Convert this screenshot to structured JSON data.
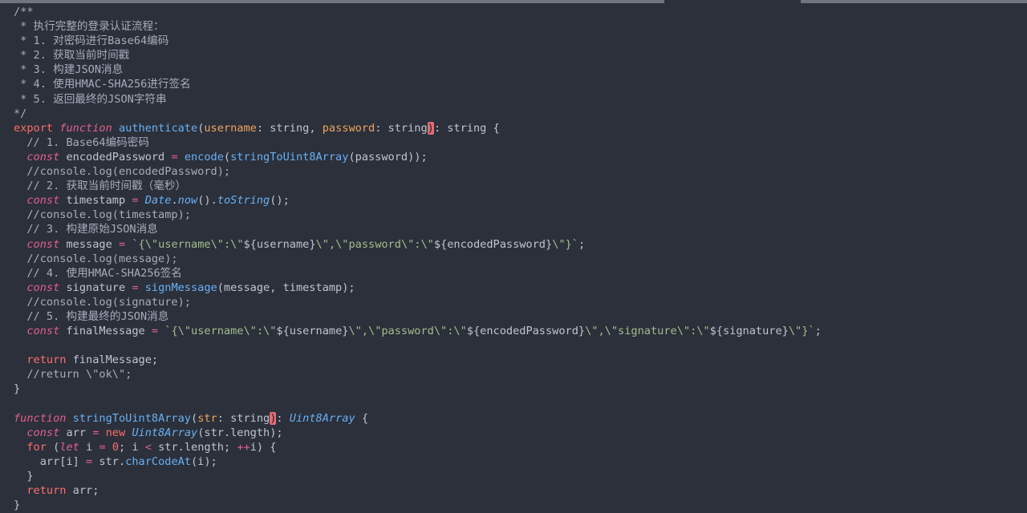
{
  "editor": {
    "lines": [
      {
        "tokens": [
          {
            "t": "/**",
            "c": "c-comment"
          }
        ]
      },
      {
        "tokens": [
          {
            "t": " * 执行完整的登录认证流程：",
            "c": "c-comment"
          }
        ]
      },
      {
        "tokens": [
          {
            "t": " * 1. 对密码进行Base64编码",
            "c": "c-comment"
          }
        ]
      },
      {
        "tokens": [
          {
            "t": " * 2. 获取当前时间戳",
            "c": "c-comment"
          }
        ]
      },
      {
        "tokens": [
          {
            "t": " * 3. 构建JSON消息",
            "c": "c-comment"
          }
        ]
      },
      {
        "tokens": [
          {
            "t": " * 4. 使用HMAC-SHA256进行签名",
            "c": "c-comment"
          }
        ]
      },
      {
        "tokens": [
          {
            "t": " * 5. 返回最终的JSON字符串",
            "c": "c-comment"
          }
        ]
      },
      {
        "tokens": [
          {
            "t": "*/",
            "c": "c-comment"
          }
        ]
      },
      {
        "tokens": [
          {
            "t": "export ",
            "c": "c-kw"
          },
          {
            "t": "function ",
            "c": "c-kwi"
          },
          {
            "t": "authenticate",
            "c": "c-fn2"
          },
          {
            "t": "(",
            "c": ""
          },
          {
            "t": "username",
            "c": "c-param"
          },
          {
            "t": ": string, ",
            "c": ""
          },
          {
            "t": "password",
            "c": "c-param"
          },
          {
            "t": ": string",
            "c": ""
          },
          {
            "t": ")",
            "c": "paren-hi"
          },
          {
            "t": ": string {",
            "c": ""
          }
        ]
      },
      {
        "tokens": [
          {
            "t": "  // 1. Base64编码密码",
            "c": "c-comment"
          }
        ]
      },
      {
        "tokens": [
          {
            "t": "  ",
            "c": ""
          },
          {
            "t": "const ",
            "c": "c-kwi"
          },
          {
            "t": "encodedPassword ",
            "c": ""
          },
          {
            "t": "= ",
            "c": "c-op"
          },
          {
            "t": "encode",
            "c": "c-fn2"
          },
          {
            "t": "(",
            "c": ""
          },
          {
            "t": "stringToUint8Array",
            "c": "c-fn2"
          },
          {
            "t": "(password));",
            "c": ""
          }
        ]
      },
      {
        "tokens": [
          {
            "t": "  //console.log(encodedPassword);",
            "c": "c-comment"
          }
        ]
      },
      {
        "tokens": [
          {
            "t": "  // 2. 获取当前时间戳（毫秒）",
            "c": "c-comment"
          }
        ]
      },
      {
        "tokens": [
          {
            "t": "  ",
            "c": ""
          },
          {
            "t": "const ",
            "c": "c-kwi"
          },
          {
            "t": "timestamp ",
            "c": ""
          },
          {
            "t": "= ",
            "c": "c-op"
          },
          {
            "t": "Date",
            "c": "c-type"
          },
          {
            "t": ".",
            "c": ""
          },
          {
            "t": "now",
            "c": "c-type"
          },
          {
            "t": "().",
            "c": ""
          },
          {
            "t": "toString",
            "c": "c-type"
          },
          {
            "t": "();",
            "c": ""
          }
        ]
      },
      {
        "tokens": [
          {
            "t": "  //console.log(timestamp);",
            "c": "c-comment"
          }
        ]
      },
      {
        "tokens": [
          {
            "t": "  // 3. 构建原始JSON消息",
            "c": "c-comment"
          }
        ]
      },
      {
        "tokens": [
          {
            "t": "  ",
            "c": ""
          },
          {
            "t": "const ",
            "c": "c-kwi"
          },
          {
            "t": "message ",
            "c": ""
          },
          {
            "t": "= ",
            "c": "c-op"
          },
          {
            "t": "`{\\\"",
            "c": "c-str"
          },
          {
            "t": "username",
            "c": "c-str"
          },
          {
            "t": "\\\":\\\"",
            "c": "c-str"
          },
          {
            "t": "${username}",
            "c": "c-tmpl"
          },
          {
            "t": "\\\",\\\"",
            "c": "c-str"
          },
          {
            "t": "password",
            "c": "c-str"
          },
          {
            "t": "\\\":\\\"",
            "c": "c-str"
          },
          {
            "t": "${encodedPassword}",
            "c": "c-tmpl"
          },
          {
            "t": "\\\"}`",
            "c": "c-str"
          },
          {
            "t": ";",
            "c": ""
          }
        ]
      },
      {
        "tokens": [
          {
            "t": "  //console.log(message);",
            "c": "c-comment"
          }
        ]
      },
      {
        "tokens": [
          {
            "t": "  // 4. 使用HMAC-SHA256签名",
            "c": "c-comment"
          }
        ]
      },
      {
        "tokens": [
          {
            "t": "  ",
            "c": ""
          },
          {
            "t": "const ",
            "c": "c-kwi"
          },
          {
            "t": "signature ",
            "c": ""
          },
          {
            "t": "= ",
            "c": "c-op"
          },
          {
            "t": "signMessage",
            "c": "c-fn2"
          },
          {
            "t": "(message, timestamp);",
            "c": ""
          }
        ]
      },
      {
        "tokens": [
          {
            "t": "  //console.log(signature);",
            "c": "c-comment"
          }
        ]
      },
      {
        "tokens": [
          {
            "t": "  // 5. 构建最终的JSON消息",
            "c": "c-comment"
          }
        ]
      },
      {
        "tokens": [
          {
            "t": "  ",
            "c": ""
          },
          {
            "t": "const ",
            "c": "c-kwi"
          },
          {
            "t": "finalMessage ",
            "c": ""
          },
          {
            "t": "= ",
            "c": "c-op"
          },
          {
            "t": "`{\\\"",
            "c": "c-str"
          },
          {
            "t": "username",
            "c": "c-str"
          },
          {
            "t": "\\\":\\\"",
            "c": "c-str"
          },
          {
            "t": "${username}",
            "c": "c-tmpl"
          },
          {
            "t": "\\\",\\\"",
            "c": "c-str"
          },
          {
            "t": "password",
            "c": "c-str"
          },
          {
            "t": "\\\":\\\"",
            "c": "c-str"
          },
          {
            "t": "${encodedPassword}",
            "c": "c-tmpl"
          },
          {
            "t": "\\\",\\\"",
            "c": "c-str"
          },
          {
            "t": "signature",
            "c": "c-str"
          },
          {
            "t": "\\\":\\\"",
            "c": "c-str"
          },
          {
            "t": "${signature}",
            "c": "c-tmpl"
          },
          {
            "t": "\\\"}`",
            "c": "c-str"
          },
          {
            "t": ";",
            "c": ""
          }
        ]
      },
      {
        "tokens": [
          {
            "t": "",
            "c": ""
          }
        ]
      },
      {
        "tokens": [
          {
            "t": "  ",
            "c": ""
          },
          {
            "t": "return ",
            "c": "c-kw"
          },
          {
            "t": "finalMessage;",
            "c": ""
          }
        ]
      },
      {
        "tokens": [
          {
            "t": "  //return \\\"ok\\\";",
            "c": "c-comment"
          }
        ]
      },
      {
        "tokens": [
          {
            "t": "}",
            "c": ""
          }
        ]
      },
      {
        "tokens": [
          {
            "t": "",
            "c": ""
          }
        ]
      },
      {
        "tokens": [
          {
            "t": "function ",
            "c": "c-kwi"
          },
          {
            "t": "stringToUint8Array",
            "c": "c-fn2"
          },
          {
            "t": "(",
            "c": ""
          },
          {
            "t": "str",
            "c": "c-param"
          },
          {
            "t": ": string",
            "c": ""
          },
          {
            "t": ")",
            "c": "paren-hi"
          },
          {
            "t": ": ",
            "c": ""
          },
          {
            "t": "Uint8Array",
            "c": "c-type"
          },
          {
            "t": " {",
            "c": ""
          }
        ]
      },
      {
        "tokens": [
          {
            "t": "  ",
            "c": ""
          },
          {
            "t": "const ",
            "c": "c-kwi"
          },
          {
            "t": "arr ",
            "c": ""
          },
          {
            "t": "= ",
            "c": "c-op"
          },
          {
            "t": "new ",
            "c": "c-kw"
          },
          {
            "t": "Uint8Array",
            "c": "c-type"
          },
          {
            "t": "(str.length);",
            "c": ""
          }
        ]
      },
      {
        "tokens": [
          {
            "t": "  ",
            "c": ""
          },
          {
            "t": "for ",
            "c": "c-kw"
          },
          {
            "t": "(",
            "c": ""
          },
          {
            "t": "let ",
            "c": "c-kwi"
          },
          {
            "t": "i ",
            "c": ""
          },
          {
            "t": "= ",
            "c": "c-op"
          },
          {
            "t": "0",
            "c": "c-num"
          },
          {
            "t": "; i ",
            "c": ""
          },
          {
            "t": "< ",
            "c": "c-op"
          },
          {
            "t": "str.length; ",
            "c": ""
          },
          {
            "t": "++",
            "c": "c-op"
          },
          {
            "t": "i) {",
            "c": ""
          }
        ]
      },
      {
        "tokens": [
          {
            "t": "    arr[i] ",
            "c": ""
          },
          {
            "t": "= ",
            "c": "c-op"
          },
          {
            "t": "str.",
            "c": ""
          },
          {
            "t": "charCodeAt",
            "c": "c-fn2"
          },
          {
            "t": "(i);",
            "c": ""
          }
        ]
      },
      {
        "tokens": [
          {
            "t": "  }",
            "c": ""
          }
        ]
      },
      {
        "tokens": [
          {
            "t": "  ",
            "c": ""
          },
          {
            "t": "return ",
            "c": "c-kw"
          },
          {
            "t": "arr;",
            "c": ""
          }
        ]
      },
      {
        "tokens": [
          {
            "t": "}",
            "c": ""
          }
        ]
      }
    ]
  }
}
